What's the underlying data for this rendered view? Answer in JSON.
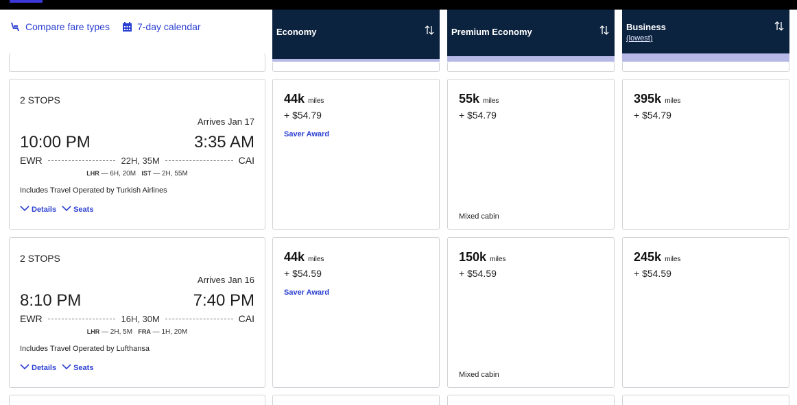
{
  "toolbar": {
    "compare_label": "Compare fare types",
    "calendar_label": "7-day calendar"
  },
  "columns": [
    {
      "label": "Economy",
      "sub": ""
    },
    {
      "label": "Premium Economy",
      "sub": ""
    },
    {
      "label": "Business",
      "sub": "(lowest)"
    }
  ],
  "flights": [
    {
      "stops": "2 STOPS",
      "arrives": "Arrives Jan 17",
      "depart_time": "10:00 PM",
      "arrive_time": "3:35 AM",
      "origin": "EWR",
      "destination": "CAI",
      "duration": "22H, 35M",
      "layover1_code": "LHR",
      "layover1_time": "— 6H, 20M",
      "layover2_code": "IST",
      "layover2_time": "— 2H, 55M",
      "operated_by": "Includes Travel Operated by Turkish Airlines",
      "details_label": "Details",
      "seats_label": "Seats",
      "fares": [
        {
          "miles": "44k",
          "unit": "miles",
          "tax": "+ $54.79",
          "note": "Saver Award",
          "footer": ""
        },
        {
          "miles": "55k",
          "unit": "miles",
          "tax": "+ $54.79",
          "note": "",
          "footer": "Mixed cabin"
        },
        {
          "miles": "395k",
          "unit": "miles",
          "tax": "+ $54.79",
          "note": "",
          "footer": ""
        }
      ]
    },
    {
      "stops": "2 STOPS",
      "arrives": "Arrives Jan 16",
      "depart_time": "8:10 PM",
      "arrive_time": "7:40 PM",
      "origin": "EWR",
      "destination": "CAI",
      "duration": "16H, 30M",
      "layover1_code": "LHR",
      "layover1_time": "— 2H, 5M",
      "layover2_code": "FRA",
      "layover2_time": "— 1H, 20M",
      "operated_by": "Includes Travel Operated by Lufthansa",
      "details_label": "Details",
      "seats_label": "Seats",
      "fares": [
        {
          "miles": "44k",
          "unit": "miles",
          "tax": "+ $54.59",
          "note": "Saver Award",
          "footer": ""
        },
        {
          "miles": "150k",
          "unit": "miles",
          "tax": "+ $54.59",
          "note": "",
          "footer": "Mixed cabin"
        },
        {
          "miles": "245k",
          "unit": "miles",
          "tax": "+ $54.59",
          "note": "",
          "footer": ""
        }
      ]
    }
  ],
  "colors": {
    "header_bg": "#0c2340",
    "accent": "#2a3ed1",
    "header_strip": "#b6b9e6"
  }
}
